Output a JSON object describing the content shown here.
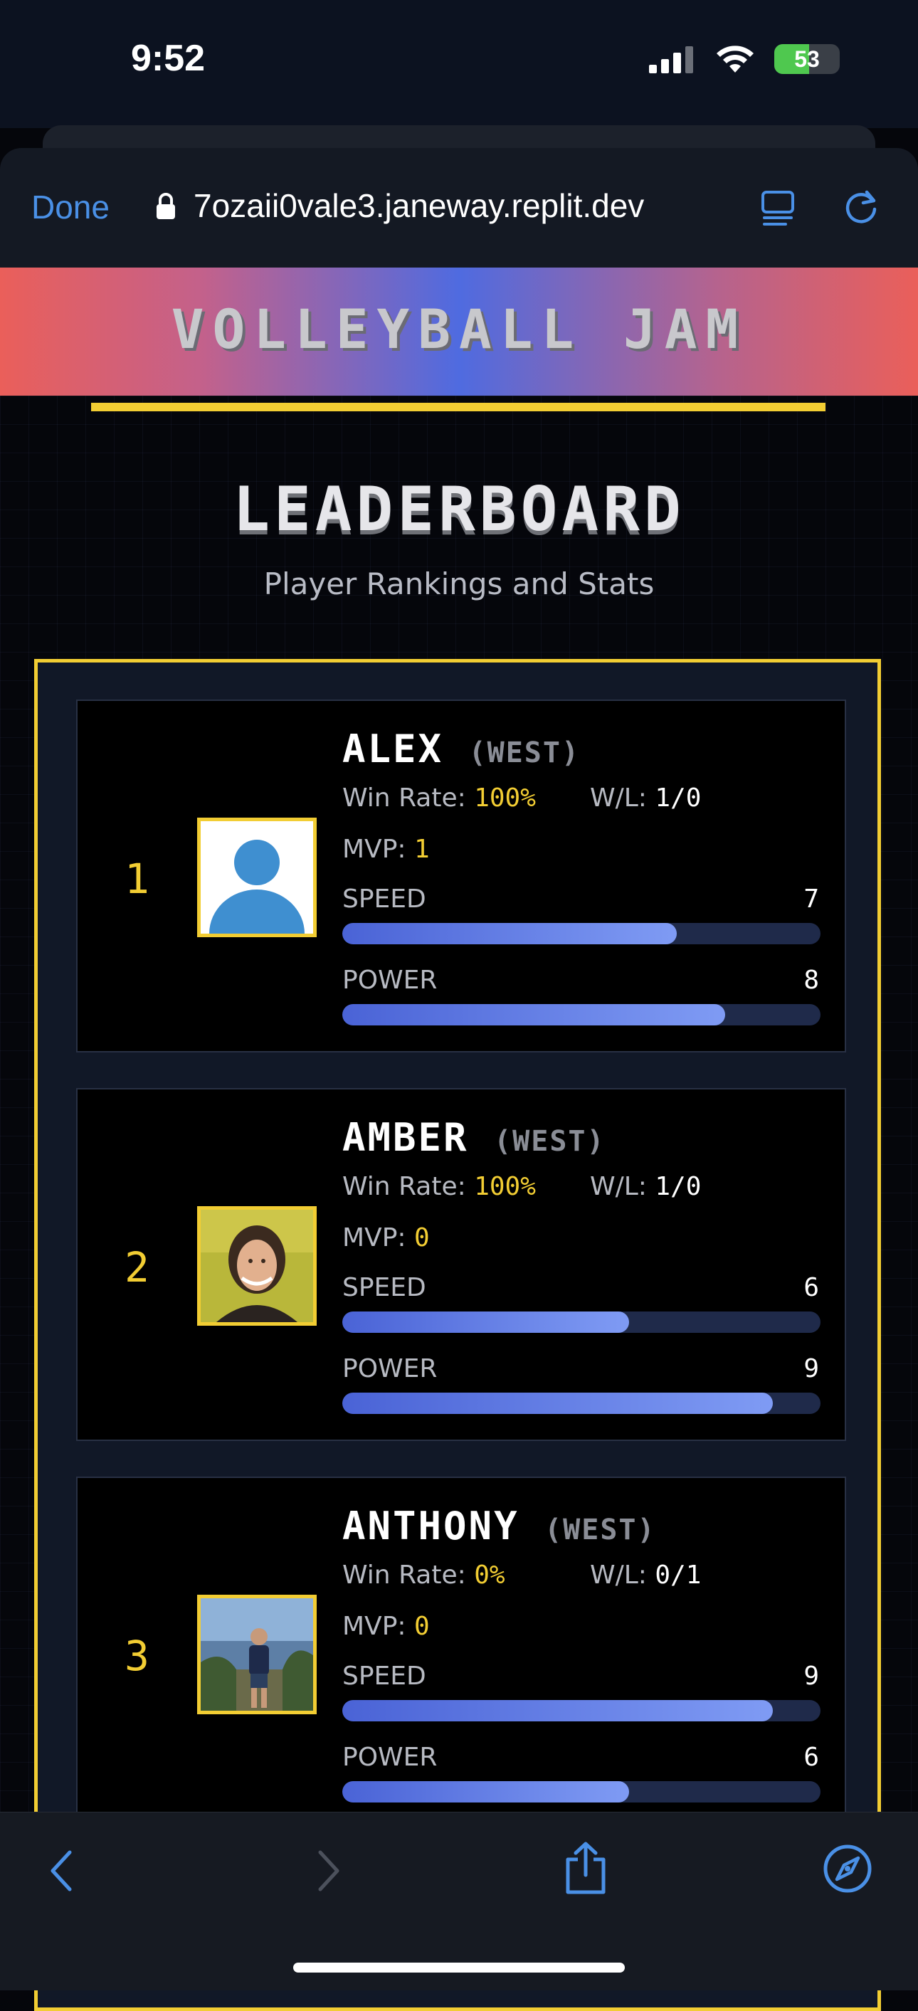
{
  "status_bar": {
    "time": "9:52",
    "battery": "53"
  },
  "browser": {
    "done_label": "Done",
    "url": "7ozaii0vale3.janeway.replit.dev"
  },
  "app": {
    "banner_title": "VOLLEYBALL JAM"
  },
  "page": {
    "title": "LEADERBOARD",
    "subtitle": "Player Rankings and Stats"
  },
  "labels": {
    "win_rate": "Win Rate:",
    "wl": "W/L:",
    "mvp": "MVP:",
    "speed": "SPEED",
    "power": "POWER"
  },
  "players": [
    {
      "rank": "1",
      "name": "ALEX",
      "region": "(WEST)",
      "win_rate": "100%",
      "wl": "1/0",
      "mvp": "1",
      "speed": "7",
      "power": "8",
      "speed_pct": 70,
      "power_pct": 80,
      "avatar": "default-avatar-icon"
    },
    {
      "rank": "2",
      "name": "AMBER",
      "region": "(WEST)",
      "win_rate": "100%",
      "wl": "1/0",
      "mvp": "0",
      "speed": "6",
      "power": "9",
      "speed_pct": 60,
      "power_pct": 90,
      "avatar": "photo"
    },
    {
      "rank": "3",
      "name": "ANTHONY",
      "region": "(WEST)",
      "win_rate": "0%",
      "wl": "0/1",
      "mvp": "0",
      "speed": "9",
      "power": "6",
      "speed_pct": 90,
      "power_pct": 60,
      "avatar": "photo"
    }
  ],
  "colors": {
    "accent": "#f2cd33",
    "bar": "#5b75e6",
    "link": "#4a90e6"
  }
}
